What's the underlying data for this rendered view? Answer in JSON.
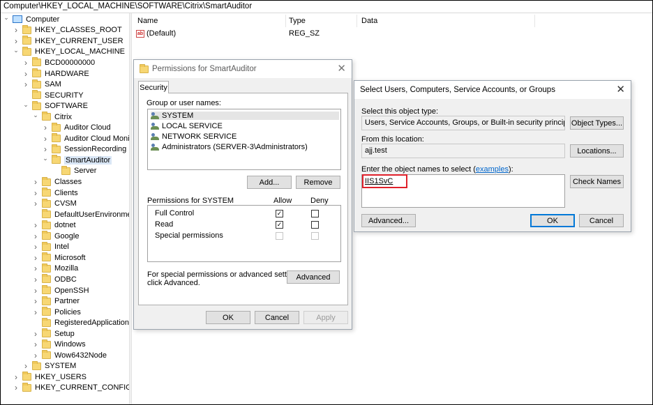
{
  "address_bar": {
    "path": "Computer\\HKEY_LOCAL_MACHINE\\SOFTWARE\\Citrix\\SmartAuditor"
  },
  "tree": {
    "items": [
      {
        "label": "Computer",
        "indent": 0,
        "expanded": true,
        "type": "computer"
      },
      {
        "label": "HKEY_CLASSES_ROOT",
        "indent": 1,
        "expanded": false
      },
      {
        "label": "HKEY_CURRENT_USER",
        "indent": 1,
        "expanded": false
      },
      {
        "label": "HKEY_LOCAL_MACHINE",
        "indent": 1,
        "expanded": true
      },
      {
        "label": "BCD00000000",
        "indent": 2,
        "expanded": false
      },
      {
        "label": "HARDWARE",
        "indent": 2,
        "expanded": false
      },
      {
        "label": "SAM",
        "indent": 2,
        "expanded": false
      },
      {
        "label": "SECURITY",
        "indent": 2,
        "expanded": null
      },
      {
        "label": "SOFTWARE",
        "indent": 2,
        "expanded": true
      },
      {
        "label": "Citrix",
        "indent": 3,
        "expanded": true
      },
      {
        "label": "Auditor Cloud",
        "indent": 4,
        "expanded": false
      },
      {
        "label": "Auditor Cloud Monit",
        "indent": 4,
        "expanded": false
      },
      {
        "label": "SessionRecording",
        "indent": 4,
        "expanded": false
      },
      {
        "label": "SmartAuditor",
        "indent": 4,
        "expanded": true,
        "selected": true
      },
      {
        "label": "Server",
        "indent": 5,
        "expanded": null
      },
      {
        "label": "Classes",
        "indent": 3,
        "expanded": false
      },
      {
        "label": "Clients",
        "indent": 3,
        "expanded": false
      },
      {
        "label": "CVSM",
        "indent": 3,
        "expanded": false
      },
      {
        "label": "DefaultUserEnvironmen",
        "indent": 3,
        "expanded": null
      },
      {
        "label": "dotnet",
        "indent": 3,
        "expanded": false
      },
      {
        "label": "Google",
        "indent": 3,
        "expanded": false
      },
      {
        "label": "Intel",
        "indent": 3,
        "expanded": false
      },
      {
        "label": "Microsoft",
        "indent": 3,
        "expanded": false
      },
      {
        "label": "Mozilla",
        "indent": 3,
        "expanded": false
      },
      {
        "label": "ODBC",
        "indent": 3,
        "expanded": false
      },
      {
        "label": "OpenSSH",
        "indent": 3,
        "expanded": false
      },
      {
        "label": "Partner",
        "indent": 3,
        "expanded": false
      },
      {
        "label": "Policies",
        "indent": 3,
        "expanded": false
      },
      {
        "label": "RegisteredApplications",
        "indent": 3,
        "expanded": null
      },
      {
        "label": "Setup",
        "indent": 3,
        "expanded": false
      },
      {
        "label": "Windows",
        "indent": 3,
        "expanded": false
      },
      {
        "label": "Wow6432Node",
        "indent": 3,
        "expanded": false
      },
      {
        "label": "SYSTEM",
        "indent": 2,
        "expanded": false
      },
      {
        "label": "HKEY_USERS",
        "indent": 1,
        "expanded": false
      },
      {
        "label": "HKEY_CURRENT_CONFIG",
        "indent": 1,
        "expanded": false
      }
    ]
  },
  "values_pane": {
    "columns": {
      "name": "Name",
      "type": "Type",
      "data": "Data"
    },
    "rows": [
      {
        "icon": "ab",
        "name": "(Default)",
        "type": "REG_SZ",
        "data": ""
      }
    ]
  },
  "permissions_dialog": {
    "title": "Permissions for SmartAuditor",
    "tab": "Security",
    "group_label": "Group or user names:",
    "users": [
      {
        "name": "SYSTEM",
        "selected": true
      },
      {
        "name": "LOCAL SERVICE"
      },
      {
        "name": "NETWORK SERVICE"
      },
      {
        "name": "Administrators (SERVER-3\\Administrators)"
      }
    ],
    "add_label": "Add...",
    "remove_label": "Remove",
    "perm_header": "Permissions for SYSTEM",
    "allow_header": "Allow",
    "deny_header": "Deny",
    "permissions": [
      {
        "name": "Full Control",
        "allow": true,
        "deny": false,
        "enabled": true
      },
      {
        "name": "Read",
        "allow": true,
        "deny": false,
        "enabled": true
      },
      {
        "name": "Special permissions",
        "allow": false,
        "deny": false,
        "enabled": false
      }
    ],
    "special_note_1": "For special permissions or advanced settings,",
    "special_note_2": "click Advanced.",
    "advanced_label": "Advanced",
    "ok_label": "OK",
    "cancel_label": "Cancel",
    "apply_label": "Apply"
  },
  "select_dialog": {
    "title": "Select Users, Computers, Service Accounts, or Groups",
    "object_type_label": "Select this object type:",
    "object_type_value": "Users, Service Accounts, Groups, or Built-in security principals",
    "object_types_button": "Object Types...",
    "location_label": "From this location:",
    "location_value": "ajj.test",
    "locations_button": "Locations...",
    "names_label_prefix": "Enter the object names to select (",
    "names_label_link": "examples",
    "names_label_suffix": "):",
    "names_value": "IIS1SvC",
    "check_names_button": "Check Names",
    "advanced_button": "Advanced...",
    "ok_button": "OK",
    "cancel_button": "Cancel",
    "highlight_color": "#e0202a"
  }
}
